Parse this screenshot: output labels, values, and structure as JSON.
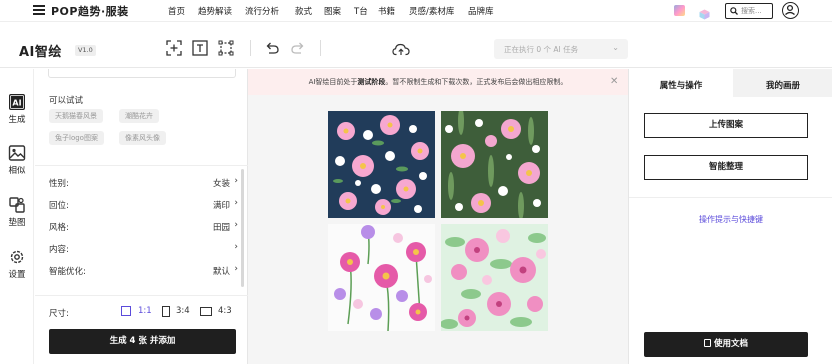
{
  "topnav": {
    "brand": "POP趋势·服装",
    "items": [
      "首页",
      "趋势解读",
      "流行分析",
      "款式",
      "图案",
      "T台",
      "书籍",
      "灵感/素材库",
      "品牌库"
    ],
    "search_placeholder": "搜索..."
  },
  "toolbar": {
    "title": "AI智绘",
    "version": "V1.0",
    "task_status": "正在执行 0 个 AI 任务"
  },
  "leftrail": {
    "items": [
      {
        "label": "生成",
        "icon": "ai-icon"
      },
      {
        "label": "相似",
        "icon": "image-icon"
      },
      {
        "label": "垫图",
        "icon": "layers-icon"
      },
      {
        "label": "设置",
        "icon": "gear-icon"
      }
    ]
  },
  "leftpanel": {
    "try_title": "可以试试",
    "suggestions": [
      "天鹅猫春风景",
      "潮酷花卉",
      "兔子logo图案",
      "像素风头像"
    ],
    "options": [
      {
        "label": "性别:",
        "value": "女装"
      },
      {
        "label": "回位:",
        "value": "满印"
      },
      {
        "label": "风格:",
        "value": "田园"
      },
      {
        "label": "内容:",
        "value": ""
      },
      {
        "label": "智能优化:",
        "value": "默认"
      }
    ],
    "size_label": "尺寸:",
    "ratios": [
      {
        "label": "1:1",
        "selected": true
      },
      {
        "label": "3:4",
        "selected": false
      },
      {
        "label": "4:3",
        "selected": false
      }
    ],
    "generate_button": "生成 4 张 并添加"
  },
  "canvas": {
    "notice_prefix": "AI智绘目前处于",
    "notice_bold": "测试阶段",
    "notice_suffix": "。暂不限制生成和下载次数，正式发布后会做出相应限制。"
  },
  "rightpanel": {
    "tabs": [
      "属性与操作",
      "我的画册"
    ],
    "active_tab": 0,
    "upload_button": "上传图案",
    "smart_button": "智能整理",
    "help_link": "操作提示与快捷键",
    "docs_button": "使用文档"
  },
  "colors": {
    "accent": "#5b4bdb",
    "dark": "#1f1f1f",
    "notice_bg": "#fdeeee",
    "link": "#5b4bdb"
  }
}
